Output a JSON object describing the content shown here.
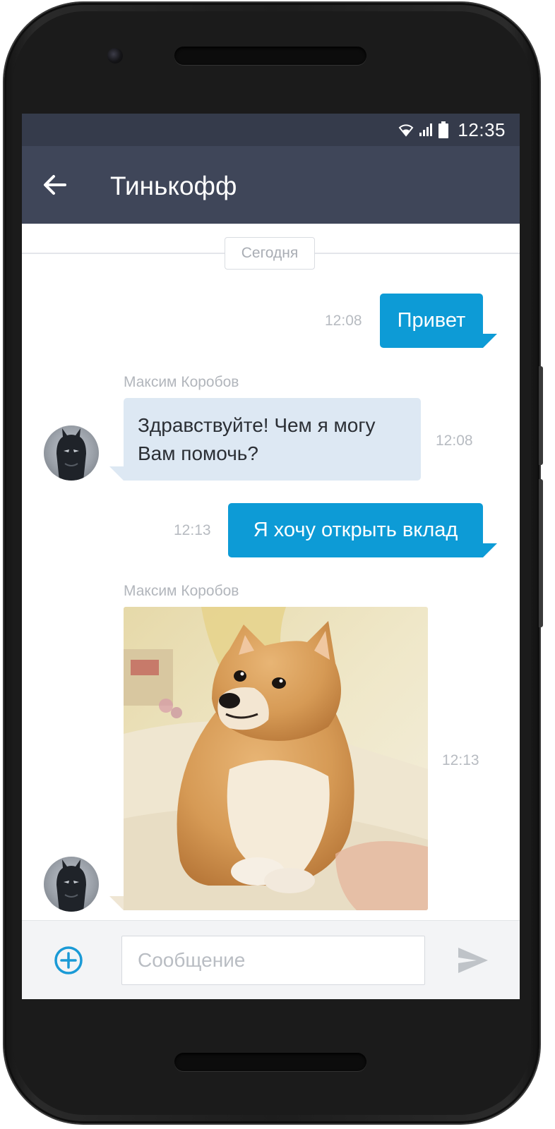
{
  "statusbar": {
    "time": "12:35",
    "icons": [
      "wifi-icon",
      "signal-icon",
      "battery-icon"
    ]
  },
  "appbar": {
    "title": "Тинькофф",
    "back_icon": "arrow-left-icon"
  },
  "chat": {
    "date_divider": "Сегодня",
    "messages": [
      {
        "direction": "out",
        "text": "Привет",
        "time": "12:08"
      },
      {
        "direction": "in",
        "sender": "Максим Коробов",
        "text_lines": [
          "Здравствуйте! Чем я могу",
          "Вам помочь?"
        ],
        "time": "12:08"
      },
      {
        "direction": "out",
        "text": "Я хочу открыть вклад",
        "time": "12:13"
      },
      {
        "direction": "in",
        "sender": "Максим Коробов",
        "type": "image",
        "image": "shiba-inu-dog-photo",
        "time": "12:13"
      }
    ]
  },
  "inputbar": {
    "placeholder": "Сообщение",
    "value": "",
    "add_icon": "plus-circle-icon",
    "send_icon": "send-icon"
  },
  "colors": {
    "statusbar": "#353b4b",
    "appbar": "#3f4659",
    "outgoing_bubble": "#0d9bd6",
    "incoming_bubble": "#dde8f3",
    "accent": "#1a9ad6"
  }
}
